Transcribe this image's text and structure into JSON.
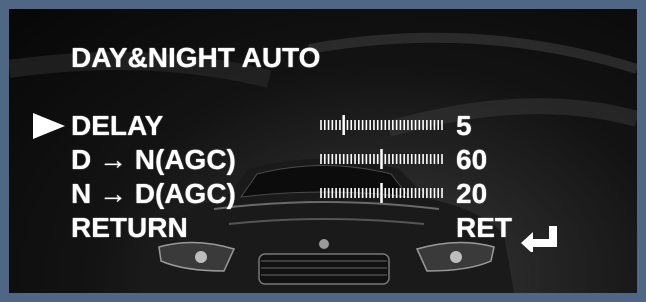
{
  "menu": {
    "title": "DAY&NIGHT AUTO",
    "items": [
      {
        "label": "DELAY",
        "value": "5",
        "level": 0.2
      },
      {
        "label": "D → N(AGC)",
        "value": "60",
        "level": 0.5
      },
      {
        "label": "N → D(AGC)",
        "value": "20",
        "level": 0.5
      }
    ],
    "return_label": "RETURN",
    "ret_value": "RET"
  },
  "icons": {
    "cursor": "selection-arrow-icon",
    "return": "enter-arrow-icon"
  },
  "colors": {
    "frame": "#4f6684",
    "text": "#ffffff"
  }
}
